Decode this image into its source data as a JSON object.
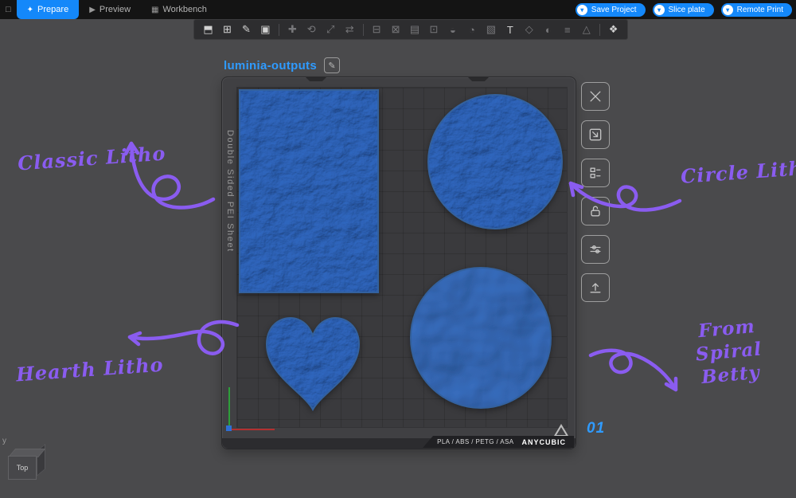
{
  "topbar": {
    "home_icon": "□",
    "action_chevron": "▾",
    "tabs": [
      {
        "label": "Prepare",
        "icon": "✦",
        "active": true
      },
      {
        "label": "Preview",
        "icon": "▶",
        "active": false
      },
      {
        "label": "Workbench",
        "icon": "▦",
        "active": false
      }
    ],
    "actions": [
      {
        "label": "Save Project"
      },
      {
        "label": "Slice plate"
      },
      {
        "label": "Remote Print"
      }
    ]
  },
  "toolbar": {
    "icons": [
      {
        "name": "add-model-icon",
        "glyph": "⬒",
        "enabled": true
      },
      {
        "name": "add-plate-icon",
        "glyph": "⊞",
        "enabled": true
      },
      {
        "name": "sketch-icon",
        "glyph": "✎",
        "enabled": true
      },
      {
        "name": "add-image-icon",
        "glyph": "▣",
        "enabled": true
      },
      {
        "name": "move-icon",
        "glyph": "✚",
        "enabled": false
      },
      {
        "name": "rotate-icon",
        "glyph": "⟲",
        "enabled": false
      },
      {
        "name": "scale-icon",
        "glyph": "⤢",
        "enabled": false
      },
      {
        "name": "mirror-icon",
        "glyph": "⇄",
        "enabled": false
      },
      {
        "name": "lay-flat-icon",
        "glyph": "⊟",
        "enabled": false
      },
      {
        "name": "split-icon",
        "glyph": "⊠",
        "enabled": false
      },
      {
        "name": "layers-icon",
        "glyph": "▤",
        "enabled": false
      },
      {
        "name": "clone-icon",
        "glyph": "⊡",
        "enabled": false
      },
      {
        "name": "support-icon",
        "glyph": "◒",
        "enabled": false
      },
      {
        "name": "seam-icon",
        "glyph": "◔",
        "enabled": false
      },
      {
        "name": "fuzzy-skin-icon",
        "glyph": "▧",
        "enabled": false
      },
      {
        "name": "text-tool-icon",
        "glyph": "T",
        "enabled": true
      },
      {
        "name": "shape-icon",
        "glyph": "◇",
        "enabled": false
      },
      {
        "name": "color-icon",
        "glyph": "◐",
        "enabled": false
      },
      {
        "name": "height-range-icon",
        "glyph": "≡",
        "enabled": false
      },
      {
        "name": "measure-icon",
        "glyph": "△",
        "enabled": false
      },
      {
        "name": "arrange-icon",
        "glyph": "❖",
        "enabled": true
      }
    ]
  },
  "plate": {
    "title": "luminia-outputs",
    "edit_icon": "✎",
    "side_label": "Double Sided PEI Sheet",
    "material_label": "PLA / ABS / PETG / ASA",
    "brand": "ANYCUBIC",
    "number": "01"
  },
  "right_toolbar": {
    "icons": [
      "close-icon",
      "lay-flat-icon",
      "arrange-objects-icon",
      "lock-icon",
      "adjust-icon",
      "lift-icon"
    ]
  },
  "objects": [
    {
      "name": "classic-litho",
      "shape": "rectangle"
    },
    {
      "name": "circle-litho",
      "shape": "circle"
    },
    {
      "name": "hearth-litho",
      "shape": "heart"
    },
    {
      "name": "spiral-betty-litho",
      "shape": "circle"
    }
  ],
  "annotations": {
    "classic": "Classic Litho",
    "circle": "Circle Litho",
    "heart": "Hearth Litho",
    "from": "From",
    "spiral": "Spiral Betty",
    "color": "#8a5cf0"
  },
  "viewcube": {
    "face": "Top",
    "axis": "y"
  },
  "colors": {
    "accent_blue": "#1488fa",
    "title_blue": "#2f9bff",
    "litho_blue": "#4d84ca",
    "annotation_purple": "#8a5cf0"
  }
}
